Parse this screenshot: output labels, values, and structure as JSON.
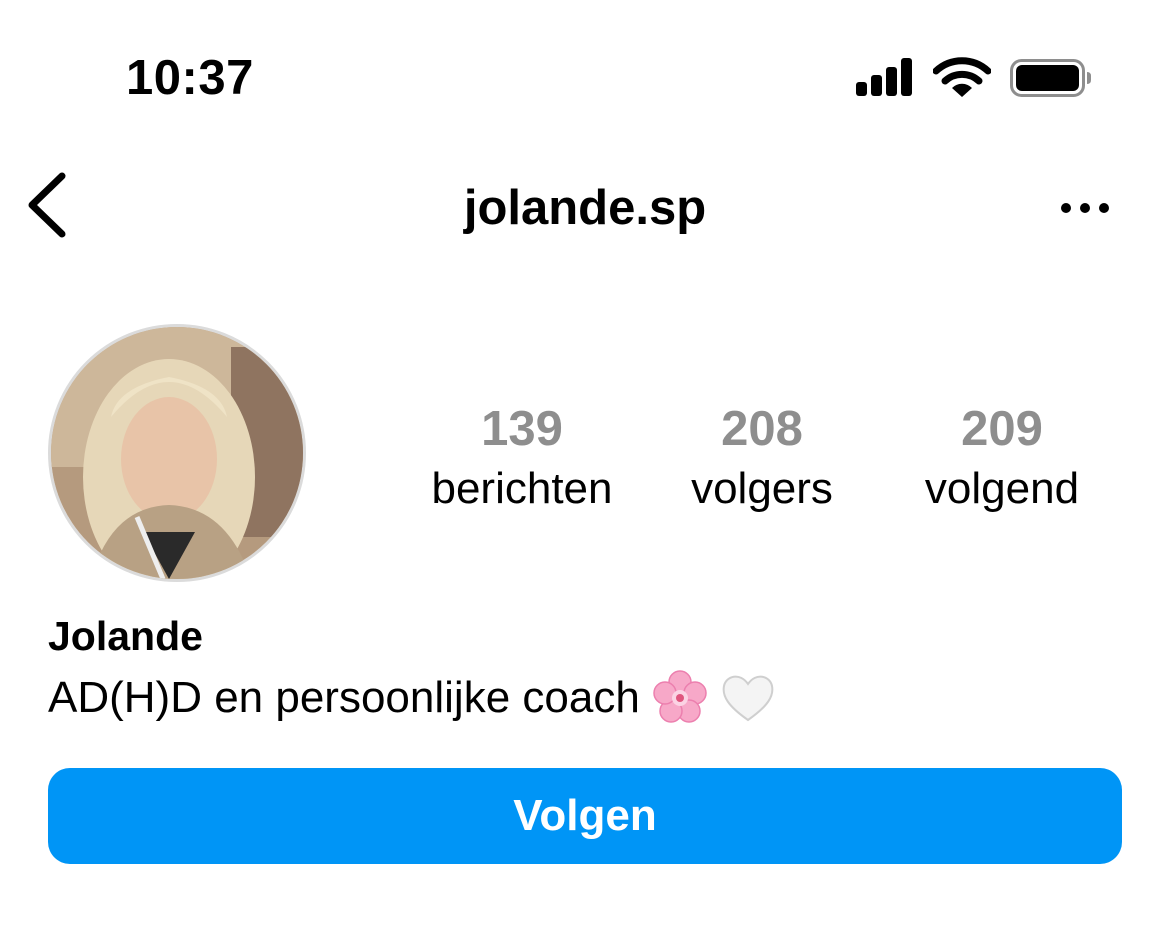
{
  "status_bar": {
    "time": "10:37",
    "icons": [
      "cellular-signal-icon",
      "wifi-icon",
      "battery-icon"
    ]
  },
  "nav": {
    "back_icon": "chevron-left-icon",
    "username": "jolande.sp",
    "more_icon": "more-horizontal-icon"
  },
  "profile": {
    "avatar": "profile-photo",
    "stats": [
      {
        "count": "139",
        "label": "berichten"
      },
      {
        "count": "208",
        "label": "volgers"
      },
      {
        "count": "209",
        "label": "volgend"
      }
    ],
    "name": "Jolande",
    "bio_text": "AD(H)D en persoonlijke coach",
    "bio_emojis": [
      "cherry-blossom-emoji",
      "white-heart-emoji"
    ]
  },
  "actions": {
    "follow_label": "Volgen"
  },
  "colors": {
    "accent": "#0095f6",
    "stat_count": "#8e8e8e",
    "avatar_ring": "#dbdbdb"
  }
}
